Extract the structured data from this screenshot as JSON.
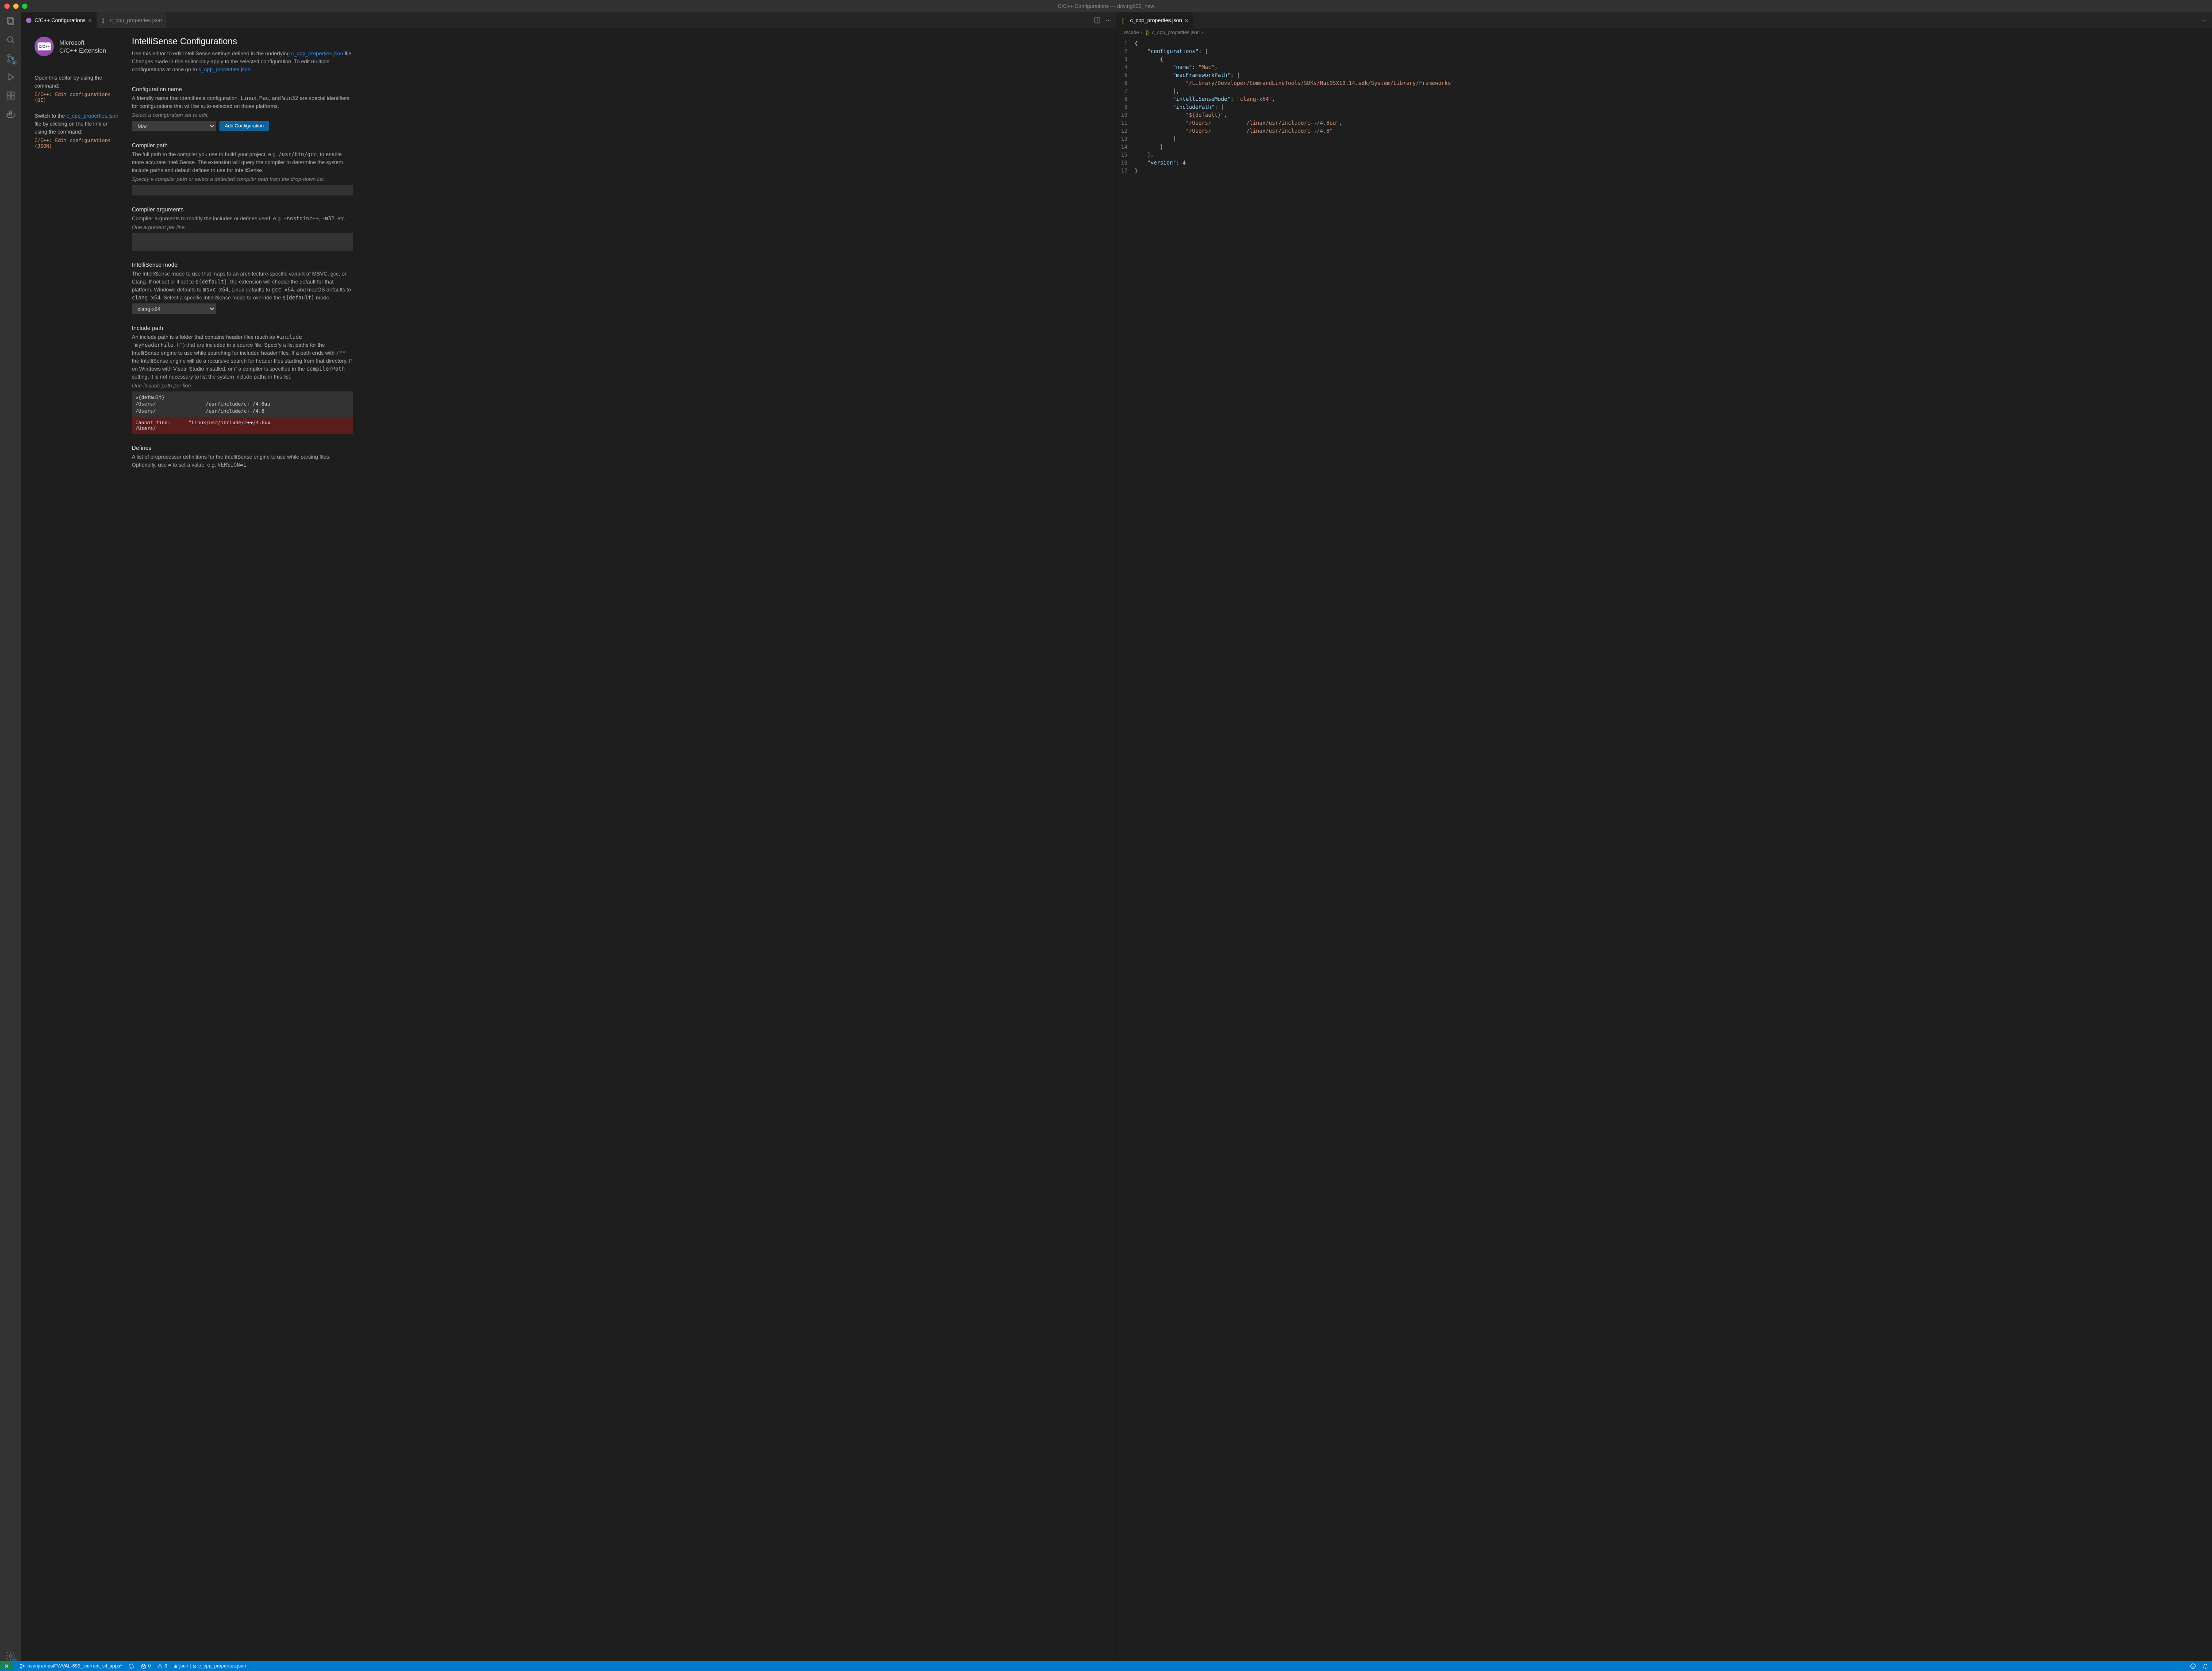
{
  "window": {
    "title": "C/C++ Configurations — driving622_new"
  },
  "tabs_left": [
    {
      "label": "C/C++ Configurations",
      "active": true,
      "icon_color": "#a074c4"
    },
    {
      "label": "c_cpp_properties.json",
      "active": false,
      "icon_color": "#cbcb41"
    }
  ],
  "tabs_right": [
    {
      "label": "c_cpp_properties.json",
      "active": true,
      "icon_color": "#cbcb41"
    }
  ],
  "breadcrumb_right": [
    ".vscode",
    "c_cpp_properties.json",
    "..."
  ],
  "activity_badges": {
    "scm": "3",
    "settings": "1"
  },
  "logo": {
    "line1": "Microsoft",
    "line2": "C/C++ Extension",
    "inner": "C/C++"
  },
  "help": {
    "open_editor": "Open this editor by using the command:",
    "open_cmd": "C/C++: Edit configurations (UI)",
    "switch_pre": "Switch to the ",
    "switch_link": "c_cpp_properties.json",
    "switch_post": " file by clicking on the file link or using the command:",
    "switch_cmd": "C/C++: Edit configurations (JSON)"
  },
  "header": {
    "title": "IntelliSense Configurations",
    "desc_pre": "Use this editor to edit IntelliSense settings defined in the underlying ",
    "link1": "c_cpp_properties.json",
    "desc_mid": " file. Changes made in this editor only apply to the selected configuration. To edit multiple configurations at once go to ",
    "link2": "c_cpp_properties.json",
    "desc_post": "."
  },
  "config_name": {
    "title": "Configuration name",
    "desc_pre": "A friendly name that identifies a configuration. ",
    "p1": "Linux",
    "p2": "Mac",
    "p3": "Win32",
    "desc_mid1": ", ",
    "desc_mid2": ", and ",
    "desc_post": " are special identifiers for configurations that will be auto-selected on those platforms.",
    "hint": "Select a configuration set to edit.",
    "selected": "Mac",
    "button": "Add Configuration"
  },
  "compiler_path": {
    "title": "Compiler path",
    "desc_pre": "The full path to the compiler you use to build your project, e.g. ",
    "code": "/usr/bin/gcc",
    "desc_post": ", to enable more accurate IntelliSense. The extension will query the compiler to determine the system include paths and default defines to use for IntelliSense.",
    "hint": "Specify a compiler path or select a detected compiler path from the drop-down list.",
    "value": ""
  },
  "compiler_args": {
    "title": "Compiler arguments",
    "desc_pre": "Compiler arguments to modify the includes or defines used, e.g. ",
    "c1": "-nostdinc++",
    "c2": "-m32",
    "desc_post": ", etc.",
    "hint": "One argument per line.",
    "value": ""
  },
  "intellisense_mode": {
    "title": "IntelliSense mode",
    "desc_pre": "The IntelliSense mode to use that maps to an architecture-specific variant of MSVC, gcc, or Clang. If not set or if set to ",
    "c1": "${default}",
    "desc_mid1": ", the extension will choose the default for that platform. Windows defaults to ",
    "c2": "msvc-x64",
    "desc_mid2": ", Linux defaults to ",
    "c3": "gcc-x64",
    "desc_mid3": ", and macOS defaults to ",
    "c4": "clang-x64",
    "desc_mid4": ". Select a specific IntelliSense mode to override the ",
    "c5": "${default}",
    "desc_post": " mode.",
    "selected": "clang-x64"
  },
  "include_path": {
    "title": "Include path",
    "desc_pre": "An include path is a folder that contains header files (such as ",
    "c1": "#include \"myHeaderFile.h\"",
    "desc_mid1": ") that are included in a source file. Specify a list paths for the IntelliSense engine to use while searching for included header files. If a path ends with ",
    "c2": "/**",
    "desc_mid2": " the IntelliSense engine will do a recursive search for header files starting from that directory. If on Windows with Visual Studio installed, or if a compiler is specified in the ",
    "c3": "compilerPath",
    "desc_post": " setting, it is not necessary to list the system include paths in this list.",
    "hint": "One include path per line.",
    "value": "${default}\n/Users/                 /usr/include/c++/4.8uu\n/Users/                 /usr/include/c++/4.8",
    "error_label": "Cannot find: /Users/",
    "error_path": "\"linux/usr/include/c++/4.8uu"
  },
  "defines": {
    "title": "Defines",
    "desc_pre": "A list of preprocessor definitions for the IntelliSense engine to use while parsing files. Optionally, use ",
    "c1": "=",
    "desc_mid": " to set a value, e.g. ",
    "c2": "VERSION=1",
    "desc_post": "."
  },
  "json_lines": [
    "{",
    "    \"configurations\": [",
    "        {",
    "            \"name\": \"Mac\",",
    "            \"macFrameworkPath\": [",
    "                \"/Library/Developer/CommandLineTools/SDKs/MacOSX10.14.sdk/System/Library/Frameworks\"",
    "            ],",
    "            \"intelliSenseMode\": \"clang-x64\",",
    "            \"includePath\": [",
    "                \"${default}\",",
    "                \"/Users/           /linux/usr/include/c++/4.8uu\",",
    "                \"/Users/           /linux/usr/include/c++/4.8\"",
    "            ]",
    "        }",
    "    ],",
    "    \"version\": 4",
    "}"
  ],
  "statusbar": {
    "branch": "user/jramos/FWVAL-699_.current_sil_apps*",
    "errors": "0",
    "warnings": "0",
    "spaces": "json | ",
    "file": "c_cpp_properties.json"
  }
}
